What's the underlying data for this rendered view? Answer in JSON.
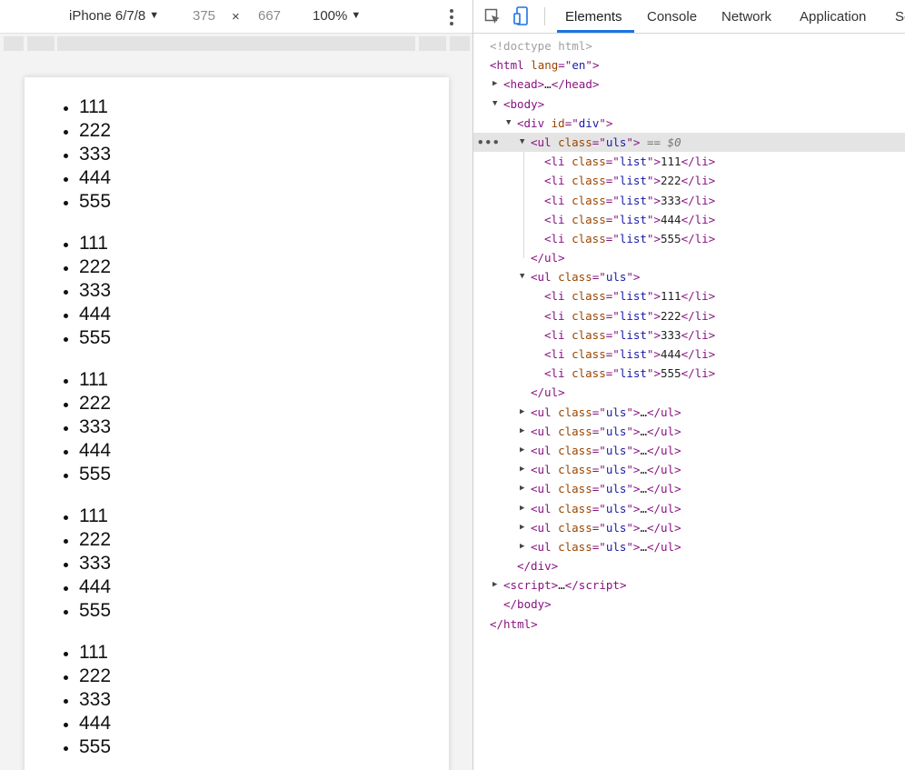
{
  "device_toolbar": {
    "device": "iPhone 6/7/8",
    "width": "375",
    "times": "×",
    "height": "667",
    "zoom": "100%"
  },
  "page_lists": [
    [
      "111",
      "222",
      "333",
      "444",
      "555"
    ],
    [
      "111",
      "222",
      "333",
      "444",
      "555"
    ],
    [
      "111",
      "222",
      "333",
      "444",
      "555"
    ],
    [
      "111",
      "222",
      "333",
      "444",
      "555"
    ],
    [
      "111",
      "222",
      "333",
      "444",
      "555"
    ]
  ],
  "devtools": {
    "tabs": [
      "Elements",
      "Console",
      "Network",
      "Application",
      "So"
    ],
    "active_tab": "Elements",
    "selected_marker": "== $0"
  },
  "tree": {
    "doctype": "<!doctype html>",
    "ul_class": "uls",
    "li_class": "list",
    "div_id": "div",
    "lang": "en",
    "expanded_items": [
      "111",
      "222",
      "333",
      "444",
      "555"
    ],
    "collapsed_ul_count": 8
  }
}
